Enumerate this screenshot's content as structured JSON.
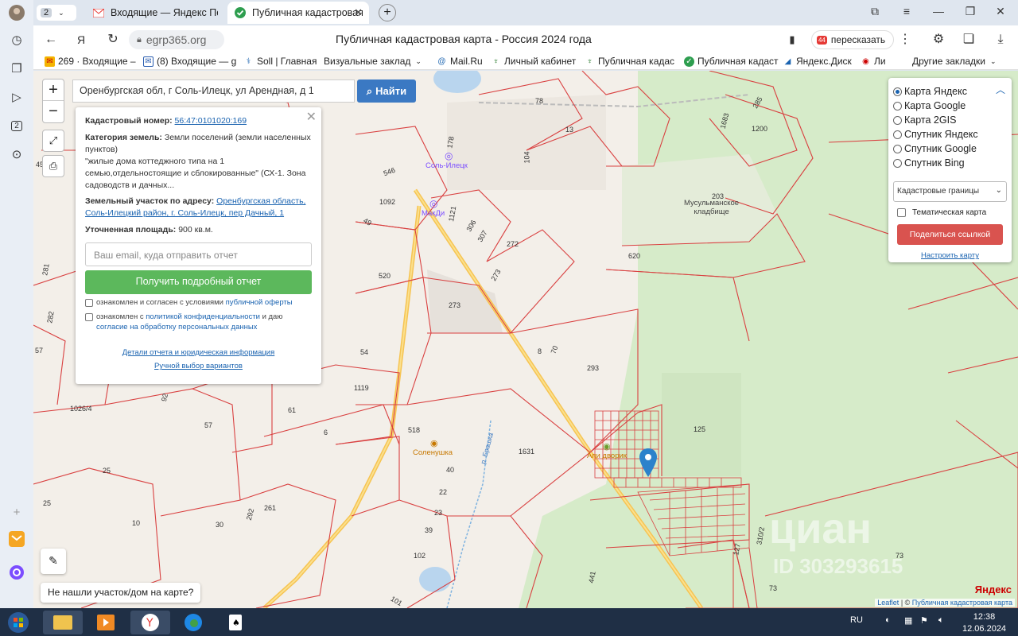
{
  "browser": {
    "tab_count": "2",
    "tabs": [
      {
        "label": "Входящие — Яндекс Почт",
        "active": false
      },
      {
        "label": "Публичная кадастровая",
        "active": true
      }
    ],
    "url": "egrp365.org",
    "page_title": "Публичная кадастровая карта - Россия 2024 года",
    "retell_label": "пересказать",
    "retell_badge": "44",
    "bookmarks": [
      "269 · Входящие –",
      "(8) Входящие — g",
      "Soll | Главная",
      "Визуальные заклад",
      "Mail.Ru",
      "Личный кабинет",
      "Публичная кадас",
      "Публичная кадаст",
      "Яндекс.Диск",
      "Ли",
      "Другие закладки"
    ]
  },
  "map": {
    "search_value": "Оренбургская обл, г Соль-Илецк, ул Арендная, д 1",
    "find_label": "Найти",
    "zoom_in": "+",
    "zoom_out": "−",
    "not_found_label": "Не нашли участок/дом на карте?",
    "parcel_labels": [
      "78",
      "13",
      "104",
      "178",
      "546",
      "1092",
      "49",
      "1121",
      "306",
      "307",
      "272",
      "273",
      "520",
      "273",
      "54",
      "1119",
      "61",
      "6",
      "57",
      "25",
      "25",
      "10",
      "30",
      "261",
      "292",
      "518",
      "40",
      "22",
      "23",
      "39",
      "102",
      "101",
      "1631",
      "293",
      "70",
      "8",
      "125",
      "203",
      "620",
      "1200",
      "1683",
      "285",
      "281",
      "282",
      "57",
      "92",
      "1026/4",
      "441",
      "73",
      "73",
      "310/2",
      "127",
      "5",
      "45",
      "20"
    ],
    "places": {
      "sol_iletsk": "Соль-Илецк",
      "mak": "МакДи",
      "cemetery": "Мусульманское\nкладбище",
      "solenushka": "Соленушка",
      "api": "Апи дворик",
      "river": "р. Ерашка"
    },
    "attribution_leaflet": "Leaflet",
    "attribution_rest": "| © ",
    "attribution_link": "Публичная кадастровая карта",
    "yandex_logo": "Яндекс",
    "watermark": "циан",
    "watermark_id": "ID 303293615"
  },
  "popup": {
    "cad_label": "Кадастровый номер:",
    "cad_value": "56:47:0101020:169",
    "cat_label": "Категория земель:",
    "cat_value": "Земли поселений (земли населенных пунктов)",
    "cat_desc": "\"жилые дома коттеджного типа на 1 семью,отдельностоящие и сблокированные\" (СХ-1. Зона садоводств и дачных...",
    "addr_label": "Земельный участок по адресу:",
    "addr_value": "Оренбургская область, Соль-Илецкий район, г. Соль-Илецк, пер Дачный, 1",
    "area_label": "Уточненная площадь:",
    "area_value": "900 кв.м.",
    "email_placeholder": "Ваш email, куда отправить отчет",
    "get_report": "Получить подробный отчет",
    "chk1_text": "ознакомлен и согласен с условиями",
    "chk1_link": "публичной оферты",
    "chk2_text": "ознакомлен с",
    "chk2_link": "политикой конфиденциальности",
    "chk2_and": "и даю",
    "chk2_link2": "согласие на обработку персональных данных",
    "details_link": "Детали отчета и юридическая информация",
    "manual_link": "Ручной выбор вариантов"
  },
  "layers": {
    "options": [
      {
        "label": "Карта Яндекс",
        "selected": true
      },
      {
        "label": "Карта Google",
        "selected": false
      },
      {
        "label": "Карта 2GIS",
        "selected": false
      },
      {
        "label": "Спутник Яндекс",
        "selected": false
      },
      {
        "label": "Спутник Google",
        "selected": false
      },
      {
        "label": "Спутник Bing",
        "selected": false
      }
    ],
    "select_value": "Кадастровые границы",
    "thematic_label": "Тематическая карта",
    "share_label": "Поделиться ссылкой",
    "configure_label": "Настроить карту"
  },
  "taskbar": {
    "lang": "RU",
    "time": "12:38",
    "date": "12.06.2024"
  }
}
